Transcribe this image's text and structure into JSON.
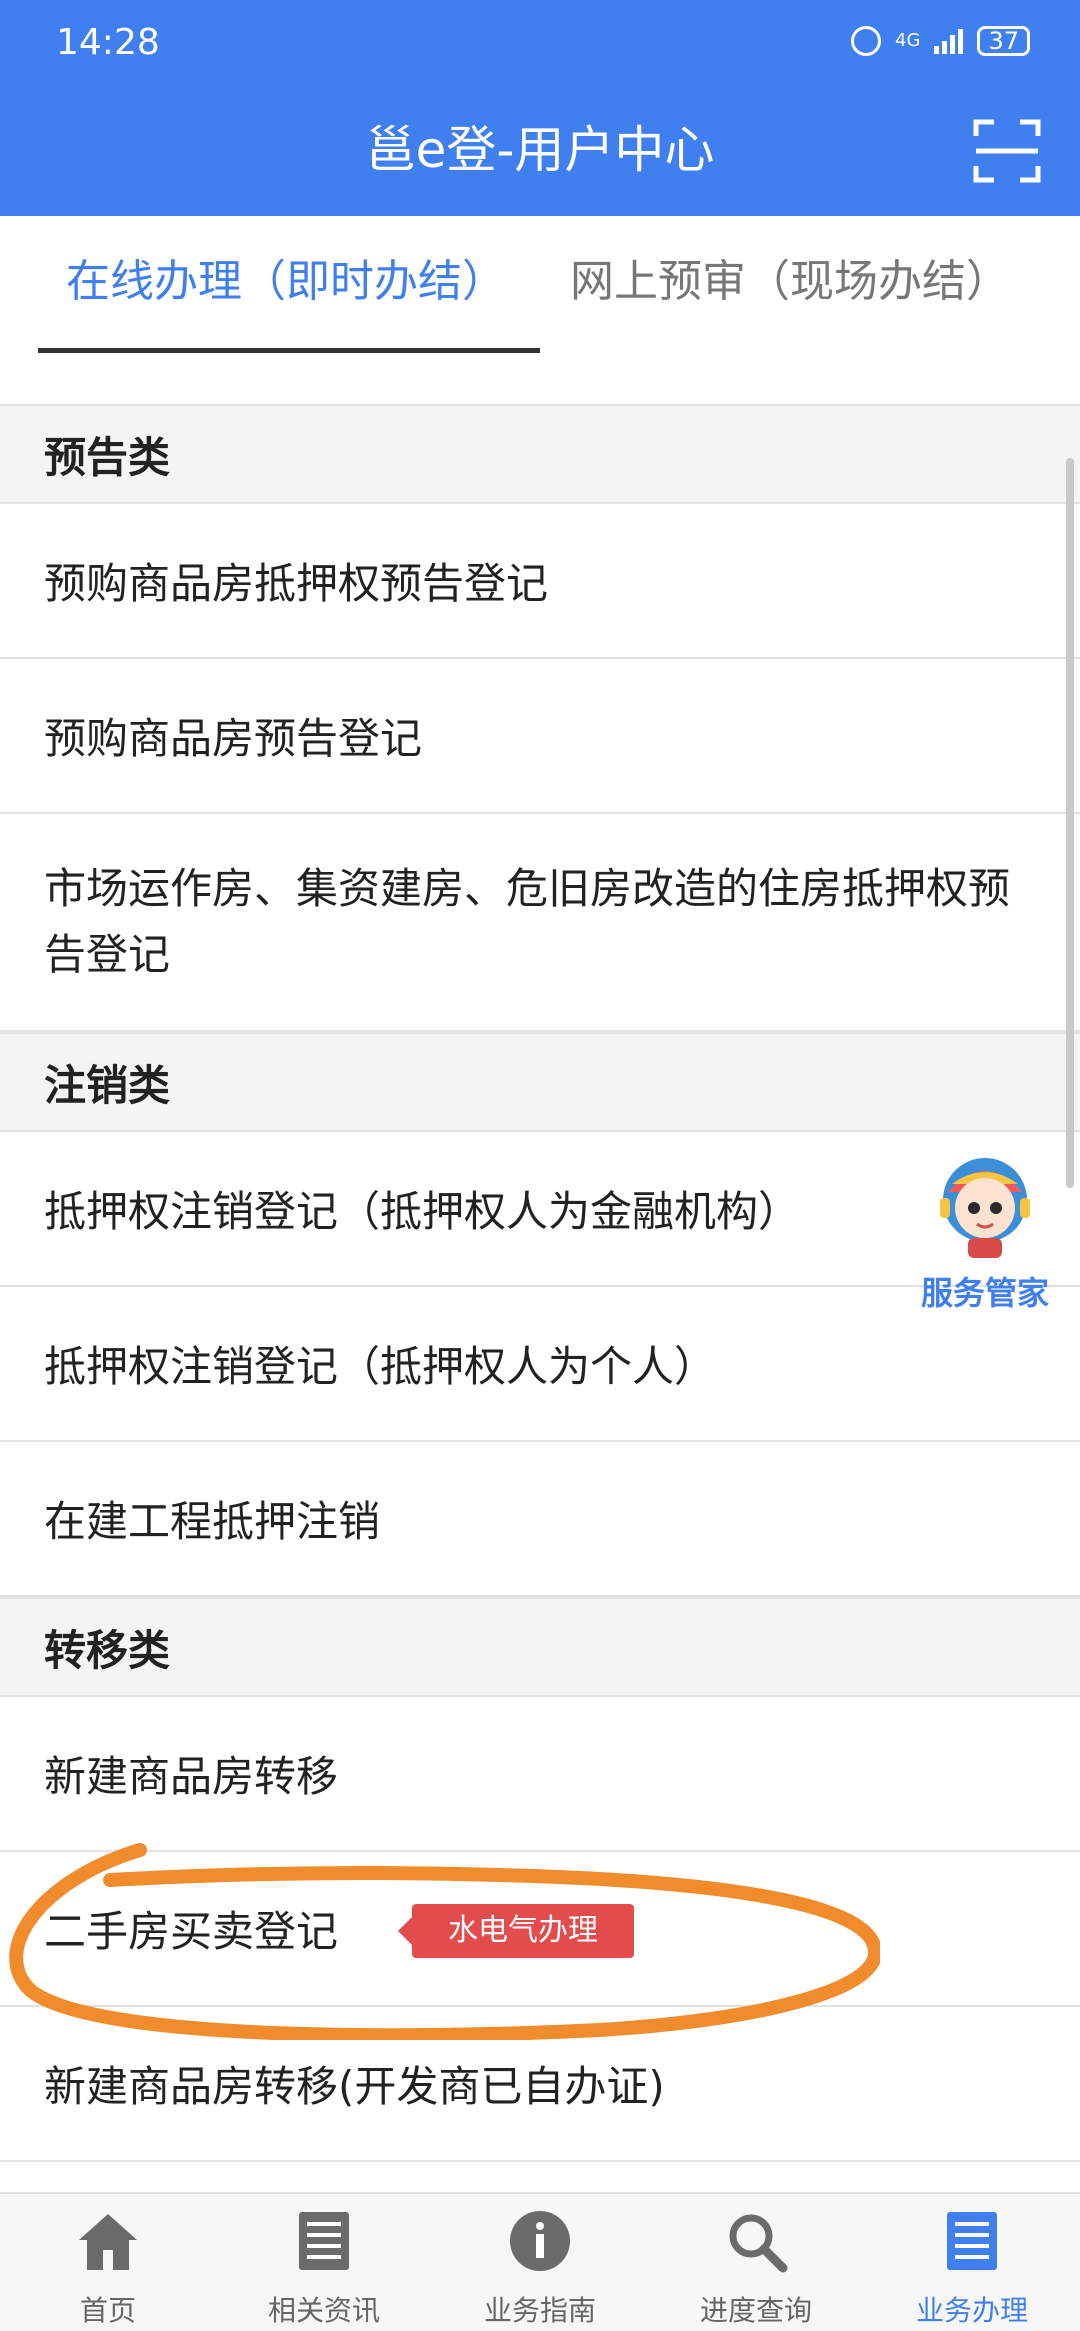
{
  "status": {
    "time": "14:28",
    "network": "4G",
    "battery": "37"
  },
  "header": {
    "title": "邕e登-用户中心"
  },
  "tabs": [
    {
      "label": "在线办理（即时办结）",
      "active": true
    },
    {
      "label": "网上预审（现场办结）",
      "active": false
    }
  ],
  "sections": [
    {
      "title": "预告类",
      "items": [
        "预购商品房抵押权预告登记",
        "预购商品房预告登记",
        "市场运作房、集资建房、危旧房改造的住房抵押权预告登记"
      ]
    },
    {
      "title": "注销类",
      "items": [
        "抵押权注销登记（抵押权人为金融机构）",
        "抵押权注销登记（抵押权人为个人）",
        "在建工程抵押注销"
      ]
    },
    {
      "title": "转移类",
      "items": [
        "新建商品房转移",
        "二手房买卖登记",
        "新建商品房转移(开发商已自办证)"
      ]
    }
  ],
  "badge": {
    "text": "水电气办理"
  },
  "butler": {
    "label": "服务管家"
  },
  "bottom_nav": [
    {
      "label": "首页",
      "icon": "home-icon",
      "active": false
    },
    {
      "label": "相关资讯",
      "icon": "news-icon",
      "active": false
    },
    {
      "label": "业务指南",
      "icon": "info-icon",
      "active": false
    },
    {
      "label": "进度查询",
      "icon": "search-icon",
      "active": false
    },
    {
      "label": "业务办理",
      "icon": "business-icon",
      "active": true
    }
  ],
  "colors": {
    "primary": "#3f7ff0",
    "badge": "#e24c4c",
    "highlight": "#f08c2c"
  }
}
